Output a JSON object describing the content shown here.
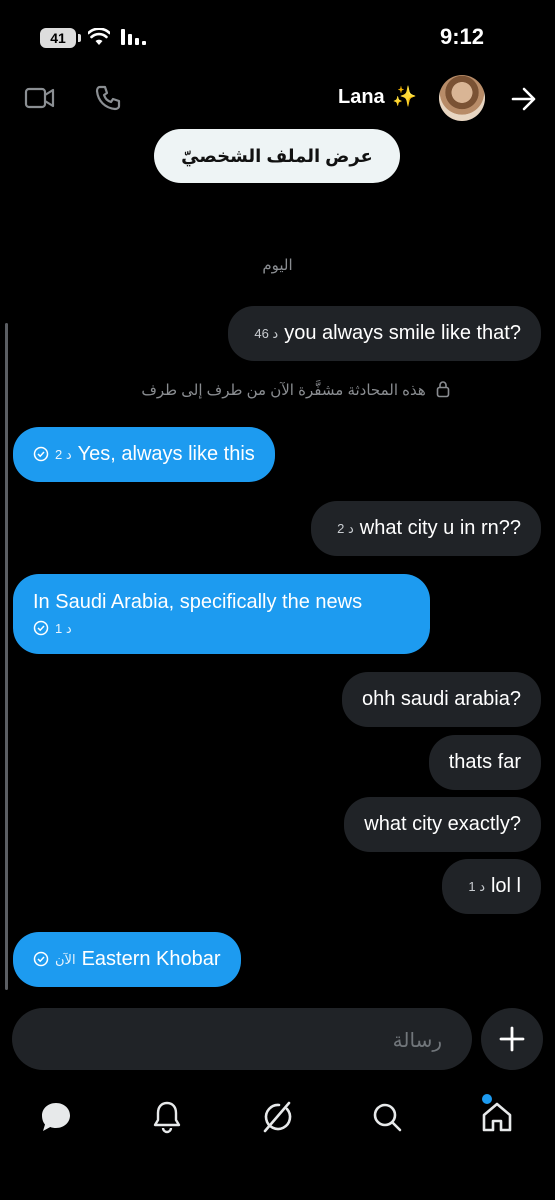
{
  "status_bar": {
    "time": "9:12",
    "battery": "41"
  },
  "header": {
    "name": "Lana",
    "sparkle": "✨",
    "profile_button": "عرض الملف الشخصيّ"
  },
  "conversation": {
    "day_label": "اليوم",
    "encryption_notice": "هذه المحادثة مشفَّرة الآن من طرف إلى طرف",
    "messages": [
      {
        "dir": "in",
        "text": "you always smile like that?",
        "time": "46 د"
      },
      {
        "dir": "out",
        "text": "Yes, always like this",
        "time": "2 د"
      },
      {
        "dir": "in",
        "text": "what city u in rn??",
        "time": "2 د"
      },
      {
        "dir": "out",
        "text": "In Saudi Arabia, specifically the news",
        "time": "1 د"
      },
      {
        "dir": "in",
        "text": "ohh saudi arabia?"
      },
      {
        "dir": "in",
        "text": "thats far"
      },
      {
        "dir": "in",
        "text": "what city exactly?"
      },
      {
        "dir": "in",
        "text": "lol l",
        "time": "1 د"
      },
      {
        "dir": "out",
        "text": "Eastern Khobar",
        "time": "الآن"
      }
    ]
  },
  "composer": {
    "placeholder": "رسالة"
  },
  "icons": {
    "header": [
      "video-call-icon",
      "phone-icon",
      "arrow-right-icon"
    ],
    "nav": [
      "messages-icon",
      "notifications-icon",
      "grok-icon",
      "search-icon",
      "home-icon"
    ]
  },
  "colors": {
    "accent": "#1d9bf0",
    "incoming_bubble": "#202327",
    "background": "#000000"
  }
}
